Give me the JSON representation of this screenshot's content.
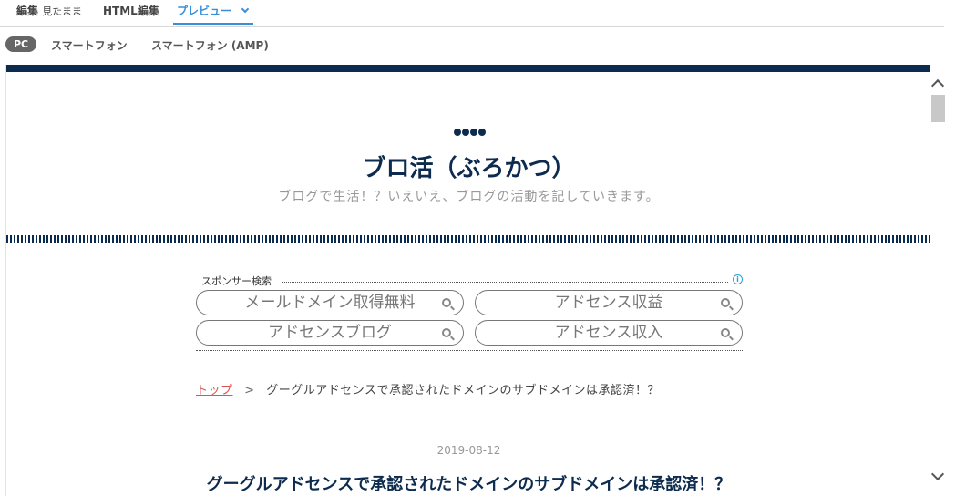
{
  "tabs": {
    "edit_label": "編集",
    "edit_sub": "見たまま",
    "html_label": "HTML編集",
    "preview_label": "プレビュー"
  },
  "devices": {
    "pc": "PC",
    "smartphone": "スマートフォン",
    "amp": "スマートフォン (AMP)"
  },
  "site": {
    "title": "ブロ活（ぶろかつ）",
    "description": "ブログで生活！？いえいえ、ブログの活動を記していきます。"
  },
  "sponsor": {
    "heading": "スポンサー検索",
    "items": [
      "メールドメイン取得無料",
      "アドセンス収益",
      "アドセンスブログ",
      "アドセンス収入"
    ]
  },
  "breadcrumb": {
    "top": "トップ",
    "separator": ">",
    "current": "グーグルアドセンスで承認されたドメインのサブドメインは承認済！？"
  },
  "post": {
    "date": "2019-08-12",
    "title": "グーグルアドセンスで承認されたドメインのサブドメインは承認済！？"
  },
  "colors": {
    "navy": "#0d2b4e",
    "accent": "#3a8fd9",
    "link": "#d9534f"
  }
}
